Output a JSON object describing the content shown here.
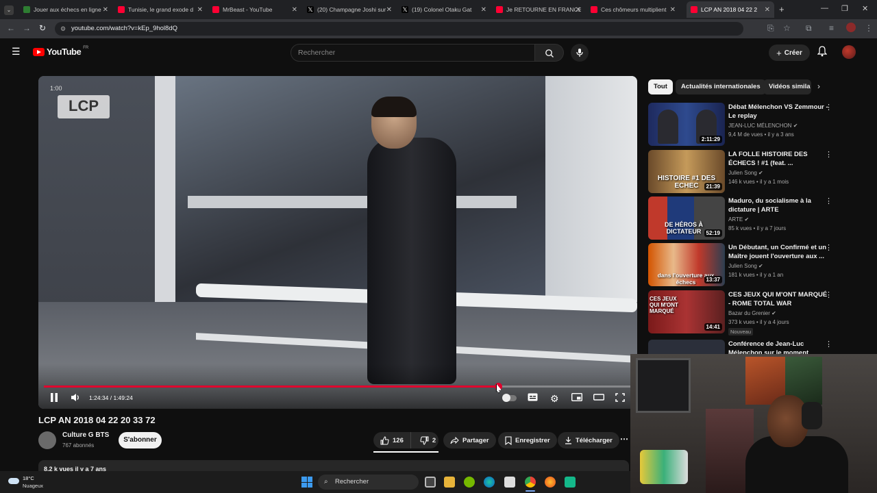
{
  "browser": {
    "tabs": [
      {
        "title": "Jouer aux échecs en ligne",
        "color": "#2e7d32"
      },
      {
        "title": "Tunisie, le grand exode d",
        "color": "#ff0033"
      },
      {
        "title": "MrBeast - YouTube",
        "color": "#ff0033"
      },
      {
        "title": "(20) Champagne Joshi sur",
        "color": "#000000"
      },
      {
        "title": "(19) Colonel Otaku Gat",
        "color": "#000000"
      },
      {
        "title": "Je RETOURNE EN FRANCE",
        "color": "#ff0033"
      },
      {
        "title": "Ces chômeurs multiplient",
        "color": "#ff0033"
      },
      {
        "title": "LCP AN 2018 04 22 2",
        "color": "#ff0033"
      }
    ],
    "url": "youtube.com/watch?v=kEp_9hol8dQ"
  },
  "header": {
    "logo": "YouTube",
    "region": "FR",
    "search_placeholder": "Rechercher",
    "create_label": "Créer"
  },
  "video": {
    "overlay_time": "1:00",
    "channel_logo": "LCP",
    "time_display": "1:24:34 / 1:49:24",
    "progress": 0.773
  },
  "info": {
    "title": "LCP AN 2018 04 22 20 33 72",
    "channel": "Culture G BTS",
    "subscribers": "767 abonnés",
    "subscribe_label": "S'abonner",
    "likes": "126",
    "dislikes": "2",
    "share_label": "Partager",
    "save_label": "Enregistrer",
    "download_label": "Télécharger",
    "views_line": "8,2 k vues  il y a 7 ans"
  },
  "sidebar": {
    "chips": [
      "Tout",
      "Actualités internationales",
      "Vidéos simila"
    ],
    "recs": [
      {
        "title": "Débat Mélenchon VS Zemmour - Le replay",
        "channel": "JEAN-LUC MÉLENCHON",
        "meta": "9,4 M de vues • il y a 3 ans",
        "duration": "2:11:29",
        "thumb_text": ""
      },
      {
        "title": "LA FOLLE HISTOIRE DES ÉCHECS ! #1 (feat. ...",
        "channel": "Julien Song",
        "meta": "146 k vues • il y a 1 mois",
        "duration": "21:39",
        "thumb_text": "HISTOIRE #1 DES ECHEC"
      },
      {
        "title": "Maduro, du socialisme à la dictature | ARTE",
        "channel": "ARTE",
        "meta": "85 k vues • il y a 7 jours",
        "duration": "52:19",
        "thumb_text": "DE HÉROS À DICTATEUR"
      },
      {
        "title": "Un Débutant, un Confirmé et un Maître jouent l'ouverture aux ...",
        "channel": "Julien Song",
        "meta": "181 k vues • il y a 1 an",
        "duration": "13:37",
        "thumb_text": "dans l'ouverture aux échecs"
      },
      {
        "title": "CES JEUX QUI M'ONT MARQUÉ - ROME TOTAL WAR",
        "channel": "Bazar du Grenier",
        "meta": "373 k vues • il y a 4 jours",
        "duration": "14:41",
        "thumb_text": "CES JEUX QUI M'ONT MARQUÉ",
        "badge": "Nouveau"
      },
      {
        "title": "Conférence de Jean-Luc Mélenchon sur le moment",
        "channel": "",
        "meta": "",
        "duration": "",
        "thumb_text": ""
      }
    ]
  },
  "taskbar": {
    "weather_temp": "18°C",
    "weather_desc": "Nuageux",
    "search_label": "Rechercher"
  }
}
